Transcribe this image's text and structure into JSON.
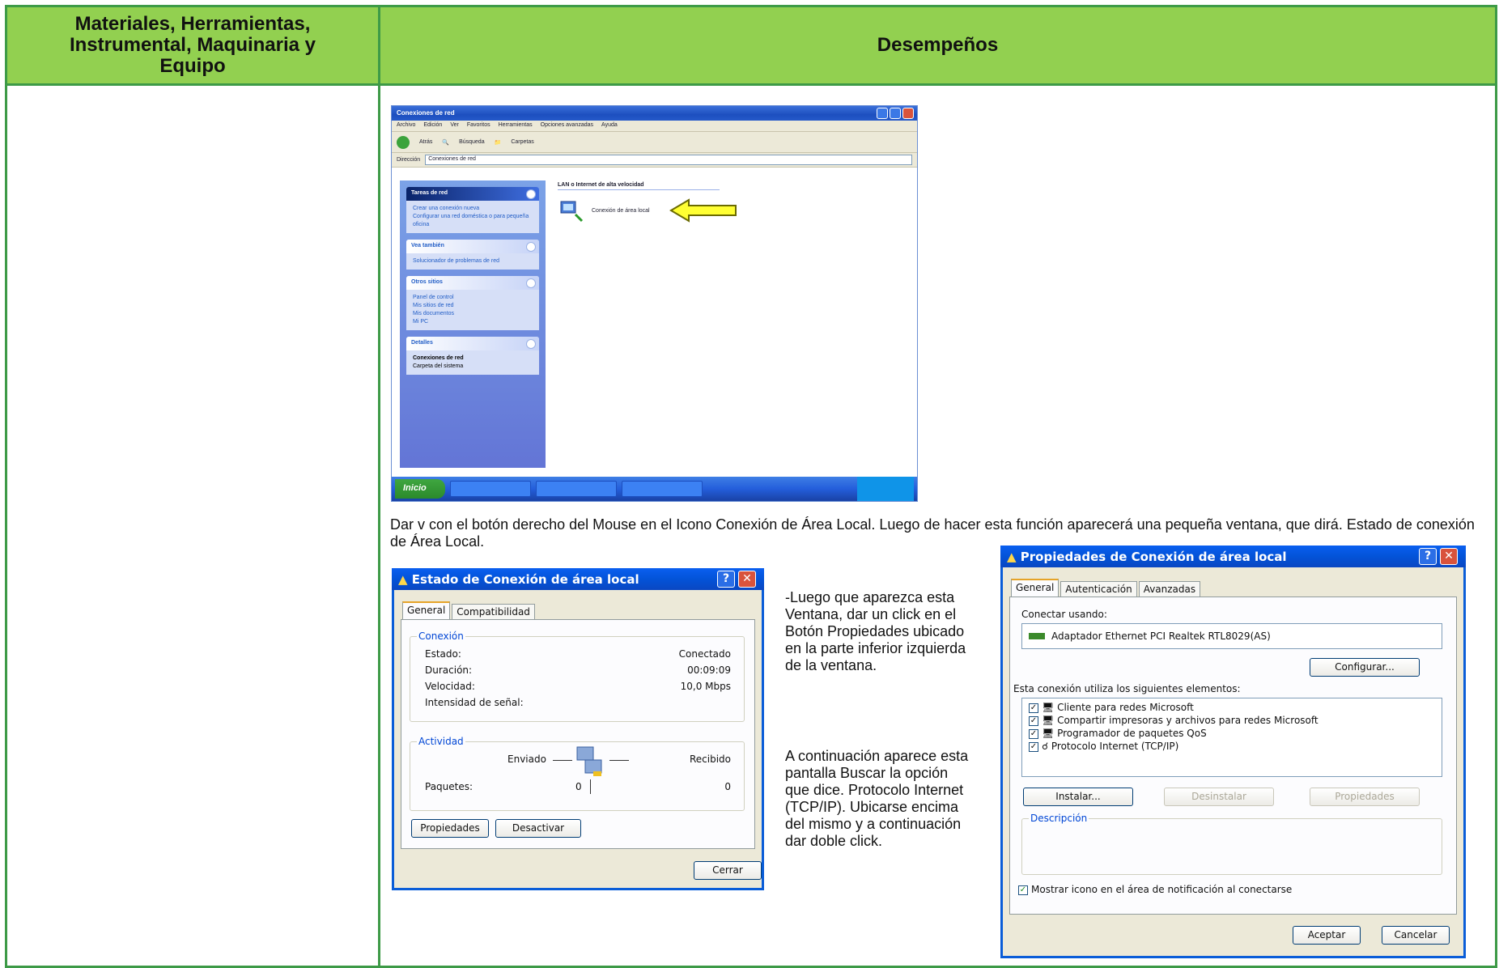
{
  "header": {
    "col1": "Materiales, Herramientas,\nInstrumental, Maquinaria y\nEquipo",
    "col2": "Desempeños"
  },
  "network_window": {
    "title": "Conexiones de red",
    "menu": [
      "Archivo",
      "Edición",
      "Ver",
      "Favoritos",
      "Herramientas",
      "Opciones avanzadas",
      "Ayuda"
    ],
    "toolbar": [
      "Atrás",
      "Búsqueda",
      "Carpetas"
    ],
    "address_label": "Dirección",
    "address": "Conexiones de red",
    "group_title": "LAN o Internet de alta velocidad",
    "item": "Conexión de área local",
    "panels": [
      {
        "title": "Tareas de red",
        "items": [
          "Crear una conexión nueva",
          "Configurar una red doméstica o para pequeña oficina"
        ]
      },
      {
        "title": "Vea también",
        "items": [
          "Solucionador de problemas de red"
        ]
      },
      {
        "title": "Otros sitios",
        "items": [
          "Panel de control",
          "Mis sitios de red",
          "Mis documentos",
          "Mi PC"
        ]
      },
      {
        "title": "Detalles",
        "items": [
          "Conexiones de red",
          "Carpeta del sistema"
        ]
      }
    ],
    "start": "Inicio"
  },
  "paragraph1": "Dar v con el botón derecho del Mouse en el Icono Conexión de Área Local. Luego de hacer esta función aparecerá una pequeña ventana, que dirá. Estado de conexión de Área Local.",
  "paragraph2": "-Luego que aparezca esta Ventana, dar un click en el Botón Propiedades ubicado en la parte inferior izquierda de la ventana.",
  "paragraph3": "A continuación aparece esta pantalla Buscar la opción que dice. Protocolo Internet (TCP/IP). Ubicarse encima del mismo y a continuación dar doble click.",
  "status_dialog": {
    "title": "Estado de Conexión de área local",
    "tabs": [
      "General",
      "Compatibilidad"
    ],
    "conexion_legend": "Conexión",
    "rows": [
      {
        "label": "Estado:",
        "value": "Conectado"
      },
      {
        "label": "Duración:",
        "value": "00:09:09"
      },
      {
        "label": "Velocidad:",
        "value": "10,0 Mbps"
      },
      {
        "label": "Intensidad de señal:",
        "value": ""
      }
    ],
    "actividad_legend": "Actividad",
    "sent": "Enviado",
    "received": "Recibido",
    "packets_label": "Paquetes:",
    "packets_sent": "0",
    "packets_received": "0",
    "btn_props": "Propiedades",
    "btn_disable": "Desactivar",
    "btn_close": "Cerrar"
  },
  "props_dialog": {
    "title": "Propiedades de Conexión de área local",
    "tabs": [
      "General",
      "Autenticación",
      "Avanzadas"
    ],
    "connect_using": "Conectar usando:",
    "adapter": "Adaptador Ethernet PCI Realtek RTL8029(AS)",
    "btn_configure": "Configurar...",
    "elements_label": "Esta conexión utiliza los siguientes elementos:",
    "elements": [
      "Cliente para redes Microsoft",
      "Compartir impresoras y archivos para redes Microsoft",
      "Programador de paquetes QoS",
      "Protocolo Internet (TCP/IP)"
    ],
    "btn_install": "Instalar...",
    "btn_uninstall": "Desinstalar",
    "btn_properties": "Propiedades",
    "desc_legend": "Descripción",
    "show_icon": "Mostrar icono en el área de notificación al conectarse",
    "btn_ok": "Aceptar",
    "btn_cancel": "Cancelar"
  }
}
